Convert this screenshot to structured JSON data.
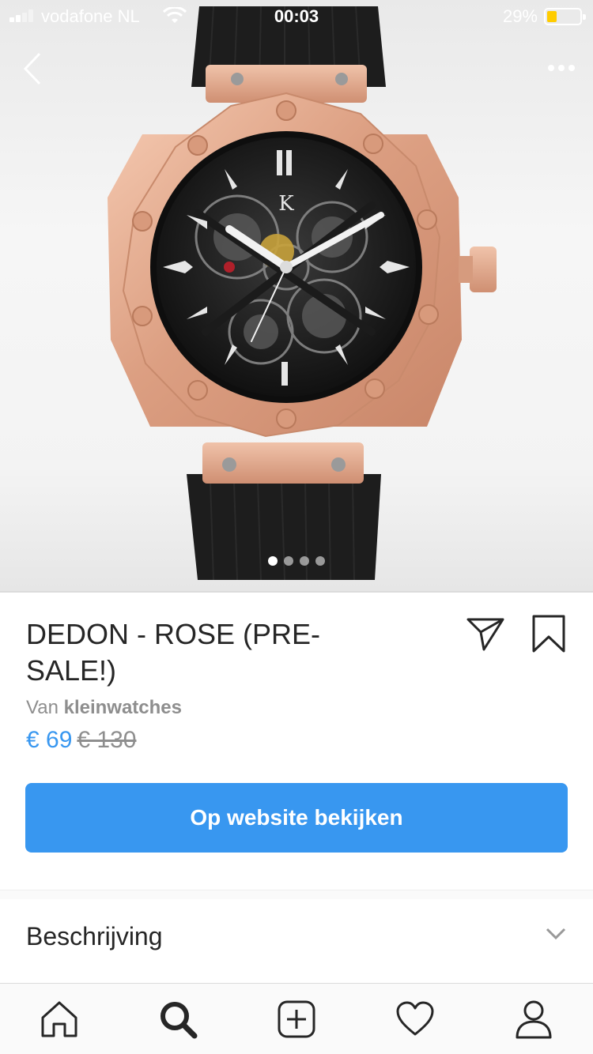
{
  "status_bar": {
    "carrier": "vodafone NL",
    "time": "00:03",
    "battery_percent": "29%",
    "signal_bars": 2,
    "battery_level": 0.29
  },
  "hero": {
    "image_alt": "Rose gold skeleton watch with black strap",
    "dial_logo": "K",
    "carousel_count": 4,
    "carousel_active": 0,
    "accent_colors": {
      "rose_gold": "#e3a98c",
      "strap": "#1f1f1f",
      "dial": "#141414"
    }
  },
  "product": {
    "title": "DEDON - ROSE (PRE-SALE!)",
    "seller_prefix": "Van",
    "seller_name": "kleinwatches",
    "price_current": "€ 69",
    "price_original": "€ 130"
  },
  "cta": {
    "label": "Op website bekijken",
    "color": "#3897f0"
  },
  "description": {
    "label": "Beschrijving"
  },
  "icons": {
    "back": "back-chevron-icon",
    "more": "more-dots-icon",
    "share": "paper-plane-icon",
    "save": "bookmark-icon",
    "expand": "chevron-down-icon"
  },
  "tabbar": {
    "items": [
      {
        "name": "home",
        "icon": "home-icon"
      },
      {
        "name": "search",
        "icon": "search-icon",
        "active": true
      },
      {
        "name": "new-post",
        "icon": "add-post-icon"
      },
      {
        "name": "activity",
        "icon": "heart-icon"
      },
      {
        "name": "profile",
        "icon": "profile-icon"
      }
    ]
  }
}
